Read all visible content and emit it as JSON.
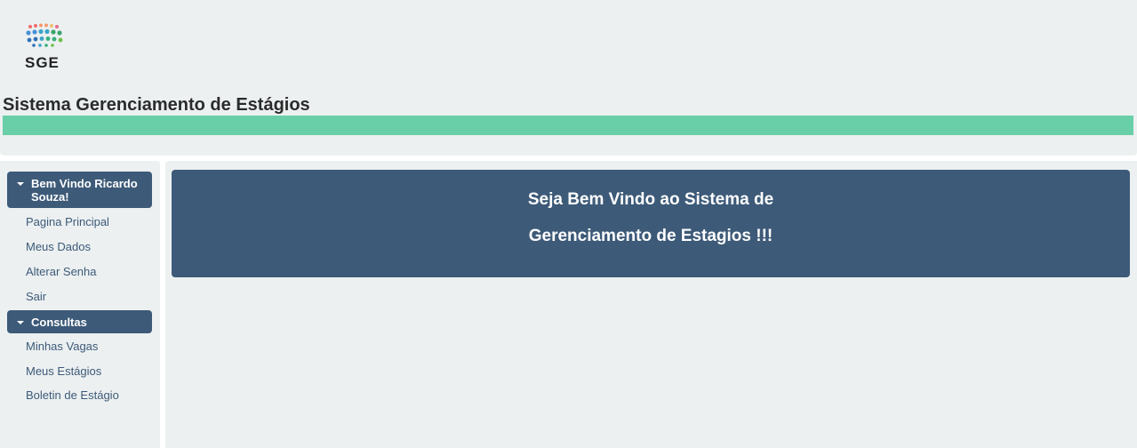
{
  "header": {
    "logo_text": "SGE",
    "title": "Sistema Gerenciamento de Estágios",
    "bar_color": "#68cfa8"
  },
  "sidebar": {
    "sections": [
      {
        "label": "Bem Vindo Ricardo Souza!",
        "icon": "caret-down-icon",
        "items": [
          "Pagina Principal",
          "Meus Dados",
          "Alterar Senha",
          "Sair"
        ]
      },
      {
        "label": "Consultas",
        "icon": "caret-down-icon",
        "items": [
          "Minhas Vagas",
          "Meus Estágios",
          "Boletin de Estágio"
        ]
      }
    ]
  },
  "main": {
    "welcome_line1": "Seja Bem Vindo ao Sistema de",
    "welcome_line2": "Gerenciamento de Estagios !!!"
  },
  "colors": {
    "panel": "#3d5a78",
    "background": "#ecf0f1",
    "link": "#3d5a78"
  }
}
